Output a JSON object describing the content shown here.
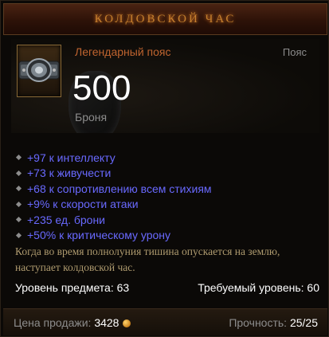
{
  "item": {
    "name": "Колдовской час",
    "type": "Легендарный пояс",
    "slot": "Пояс",
    "armor_value": "500",
    "armor_label": "Броня",
    "icon": "belt-icon"
  },
  "affixes": [
    "+97 к интеллекту",
    "+73 к живучести",
    "+68 к сопротивлению всем стихиям",
    "+9% к скорости атаки",
    "+235 ед. брони",
    "+50% к критическому урону"
  ],
  "flavor_text": {
    "line1": "Когда во время полнолуния тишина опускается на землю,",
    "line2": "наступает колдовской час."
  },
  "levels": {
    "item_level": "Уровень предмета: 63",
    "required_level": "Требуемый уровень: 60"
  },
  "footer": {
    "sell_label": "Цена продажи:",
    "sell_value": "3428",
    "durability_label": "Прочность:",
    "durability_value": "25/25",
    "gold_icon": "gold-coin-icon"
  },
  "colors": {
    "title": "#c8802f",
    "legendary": "#bf642f",
    "affix": "#6969ff",
    "flavor": "#ae9a6e",
    "muted": "#8c8c8c"
  }
}
